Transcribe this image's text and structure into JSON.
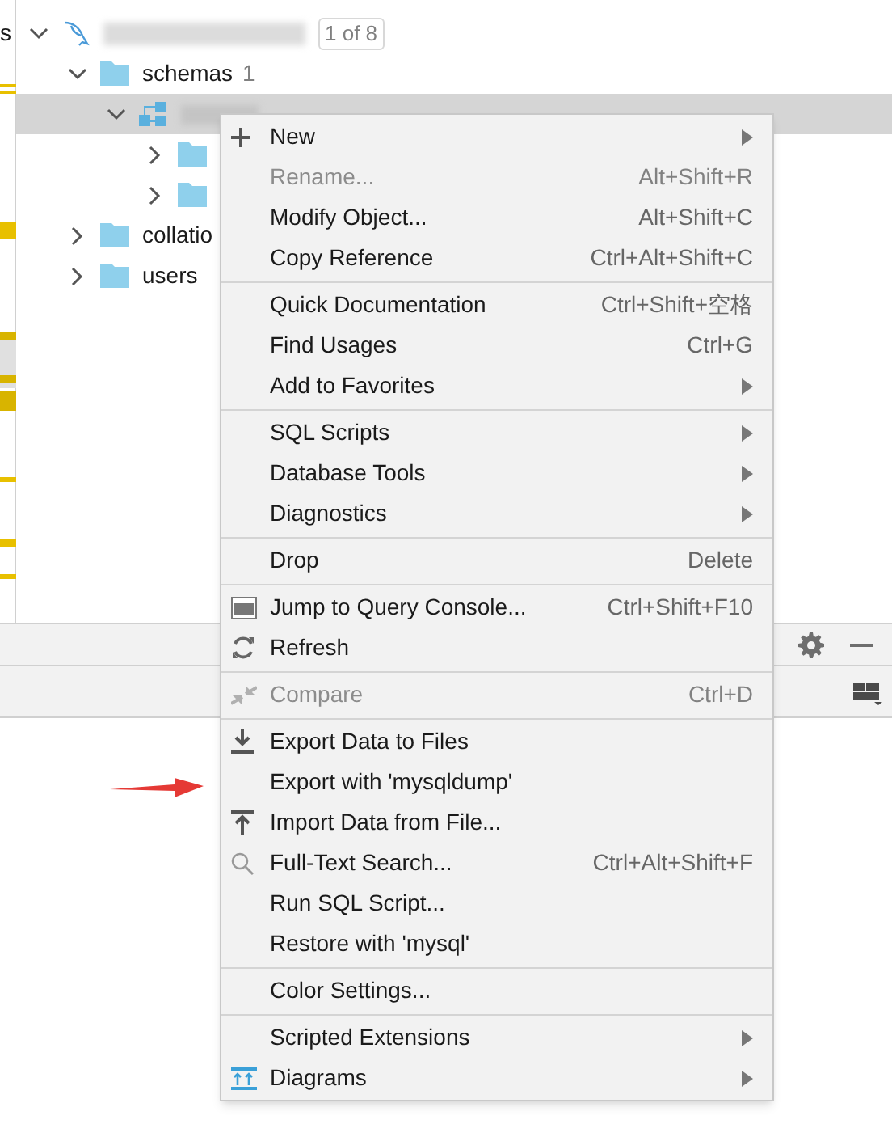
{
  "edge_fragment": "s",
  "tree": [
    {
      "kind": "datasource",
      "badge": "1 of 8",
      "expanded": true,
      "selected": false,
      "children": [
        {
          "kind": "folder",
          "label": "schemas",
          "count": "1",
          "expanded": true,
          "selected": false,
          "children": [
            {
              "kind": "schema",
              "expanded": true,
              "selected": true,
              "children": [
                {
                  "kind": "folder",
                  "expanded": false,
                  "selected": false
                },
                {
                  "kind": "folder",
                  "expanded": false,
                  "selected": false
                }
              ]
            }
          ]
        },
        {
          "kind": "folder",
          "label": "collatio",
          "expanded": false,
          "selected": false
        },
        {
          "kind": "folder",
          "label": "users",
          "expanded": false,
          "selected": false
        }
      ]
    }
  ],
  "context_menu": {
    "groups": [
      [
        {
          "label": "New",
          "kind": "plus",
          "submenu": true,
          "disabled": false
        },
        {
          "label": "Rename...",
          "shortcut": "Alt+Shift+R",
          "submenu": false,
          "disabled": true
        },
        {
          "label": "Modify Object...",
          "shortcut": "Alt+Shift+C",
          "submenu": false,
          "disabled": false
        },
        {
          "label": "Copy Reference",
          "shortcut": "Ctrl+Alt+Shift+C",
          "submenu": false,
          "disabled": false
        }
      ],
      [
        {
          "label": "Quick Documentation",
          "shortcut": "Ctrl+Shift+空格",
          "submenu": false,
          "disabled": false
        },
        {
          "label": "Find Usages",
          "shortcut": "Ctrl+G",
          "submenu": false,
          "disabled": false
        },
        {
          "label": "Add to Favorites",
          "submenu": true,
          "disabled": false
        }
      ],
      [
        {
          "label": "SQL Scripts",
          "submenu": true,
          "disabled": false
        },
        {
          "label": "Database Tools",
          "submenu": true,
          "disabled": false
        },
        {
          "label": "Diagnostics",
          "submenu": true,
          "disabled": false
        }
      ],
      [
        {
          "label": "Drop",
          "shortcut": "Delete",
          "submenu": false,
          "disabled": false
        }
      ],
      [
        {
          "label": "Jump to Query Console...",
          "kind": "console",
          "shortcut": "Ctrl+Shift+F10",
          "submenu": false,
          "disabled": false
        },
        {
          "label": "Refresh",
          "kind": "refresh",
          "submenu": false,
          "disabled": false
        }
      ],
      [
        {
          "label": "Compare",
          "kind": "compare",
          "shortcut": "Ctrl+D",
          "submenu": false,
          "disabled": true
        }
      ],
      [
        {
          "label": "Export Data to Files",
          "kind": "export",
          "submenu": false,
          "disabled": false
        },
        {
          "label": "Export with 'mysqldump'",
          "submenu": false,
          "disabled": false
        },
        {
          "label": "Import Data from File...",
          "kind": "import",
          "submenu": false,
          "disabled": false
        },
        {
          "label": "Full-Text Search...",
          "kind": "search",
          "shortcut": "Ctrl+Alt+Shift+F",
          "submenu": false,
          "disabled": false
        },
        {
          "label": "Run SQL Script...",
          "submenu": false,
          "disabled": false
        },
        {
          "label": "Restore with 'mysql'",
          "submenu": false,
          "disabled": false
        }
      ],
      [
        {
          "label": "Color Settings...",
          "submenu": false,
          "disabled": false
        }
      ],
      [
        {
          "label": "Scripted Extensions",
          "submenu": true,
          "disabled": false
        },
        {
          "label": "Diagrams",
          "kind": "diagram",
          "submenu": true,
          "disabled": false
        }
      ]
    ]
  }
}
